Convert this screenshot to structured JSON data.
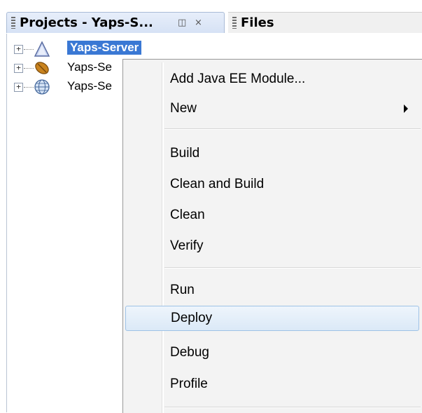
{
  "tabs": {
    "projects_title": "Projects - Yaps-S...",
    "minimize_glyph": "◫",
    "close_glyph": "×",
    "files_title": "Files"
  },
  "tree": {
    "nodes": [
      {
        "label": "Yaps-Server",
        "icon": "enterprise-app-icon",
        "selected": true
      },
      {
        "label": "Yaps-Se",
        "icon": "ejb-module-icon",
        "selected": false
      },
      {
        "label": "Yaps-Se",
        "icon": "web-module-icon",
        "selected": false
      }
    ],
    "expander_glyph": "+"
  },
  "context_menu": {
    "items": [
      {
        "label": "Add Java EE Module..."
      },
      {
        "label": "New",
        "submenu": true
      },
      {
        "label": "Build"
      },
      {
        "label": "Clean and Build"
      },
      {
        "label": "Clean"
      },
      {
        "label": "Verify"
      },
      {
        "label": "Run"
      },
      {
        "label": "Deploy",
        "highlighted": true
      },
      {
        "label": "Debug"
      },
      {
        "label": "Profile"
      }
    ]
  },
  "colors": {
    "selection": "#3a78d4",
    "menu_background": "#f3f3f3",
    "menu_highlight_border": "#9ec2e6"
  }
}
